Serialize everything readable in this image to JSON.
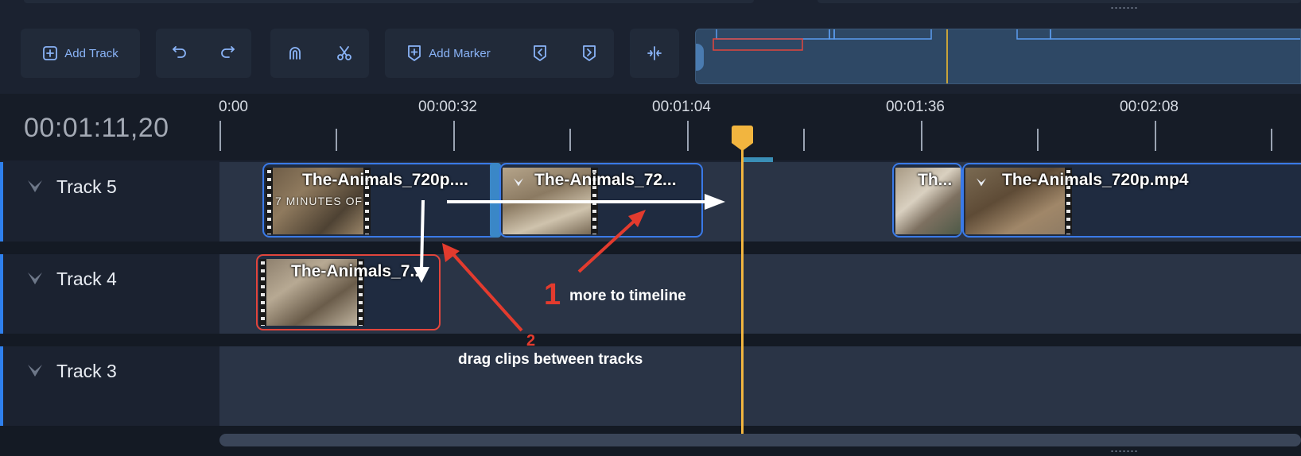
{
  "toolbar": {
    "add_track_label": "Add Track",
    "add_marker_label": "Add Marker"
  },
  "timecode": "00:01:11,20",
  "ruler": {
    "labels": [
      "0:00",
      "00:00:32",
      "00:01:04",
      "00:01:36",
      "00:02:08"
    ]
  },
  "tracks": [
    {
      "name": "Track 5"
    },
    {
      "name": "Track 4"
    },
    {
      "name": "Track 3"
    }
  ],
  "clips": {
    "t5_a": "The-Animals_720p....",
    "t5_b": "The-Animals_72...",
    "t5_c": "Th...",
    "t5_d": "The-Animals_720p.mp4",
    "t4_a": "The-Animals_7...",
    "t5_a_burnin": "7 MINUTES OF"
  },
  "annotations": {
    "step1_num": "1",
    "step1_text": "more to timeline",
    "step2_num": "2",
    "step2_text": "drag clips between tracks"
  },
  "colors": {
    "accent": "#2f80ed",
    "playhead": "#f2b53f",
    "selected_clip": "#e2453c",
    "annotation_arrow": "#e33b2e"
  },
  "icons": [
    "add-square-icon",
    "undo-icon",
    "redo-icon",
    "magnet-snap-icon",
    "scissors-icon",
    "marker-add-icon",
    "previous-marker-icon",
    "next-marker-icon",
    "collapse-gap-icon",
    "chevron-down-icon"
  ]
}
